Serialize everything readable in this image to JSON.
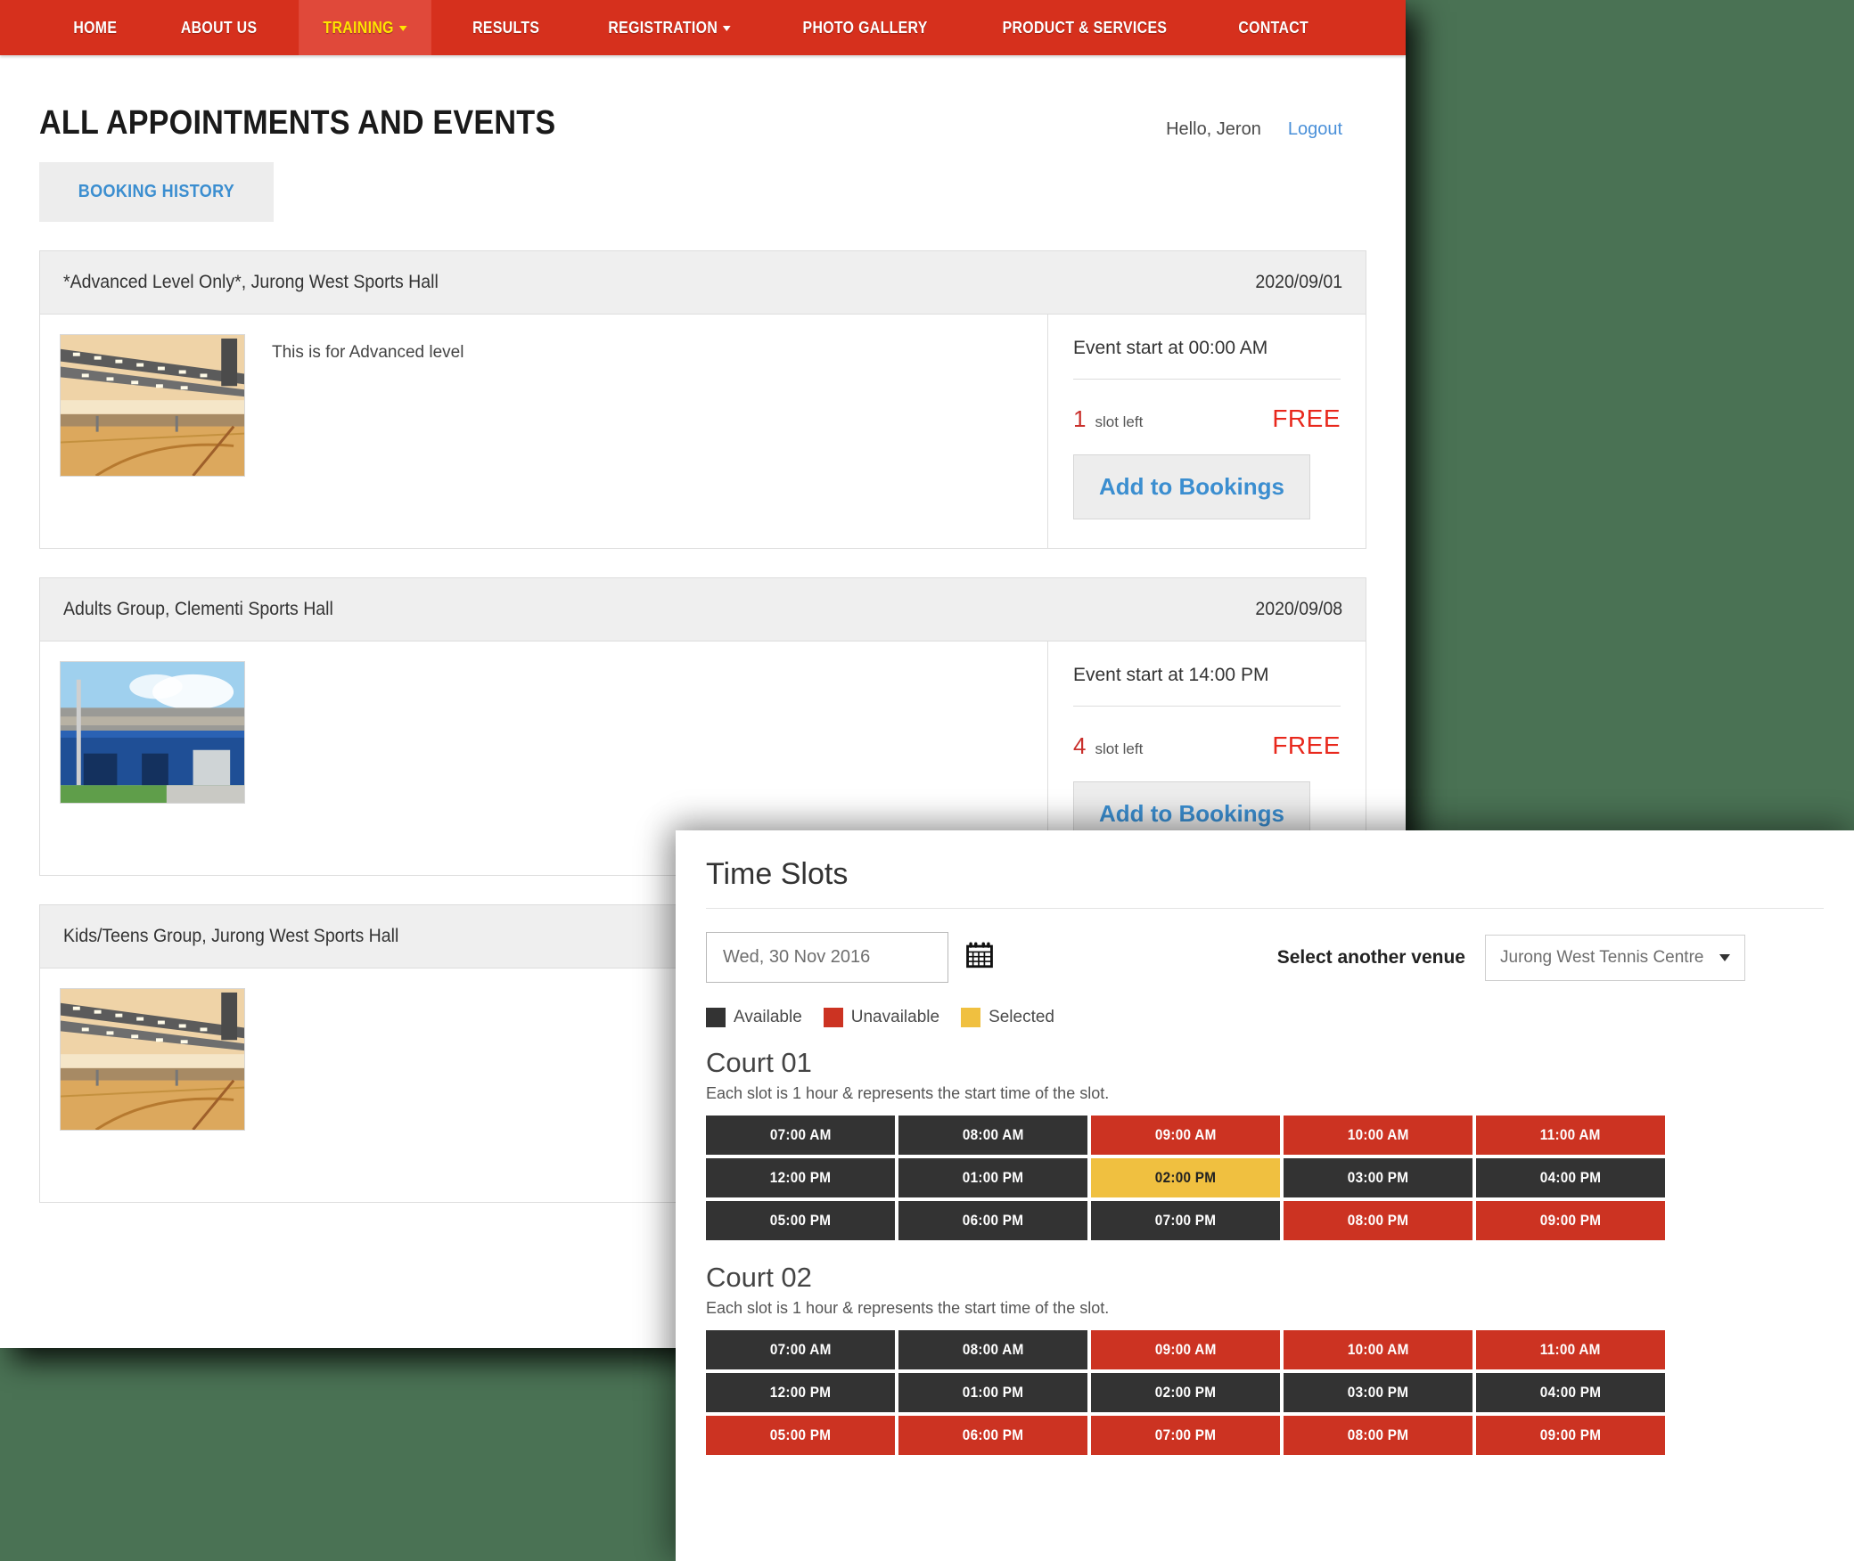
{
  "nav": {
    "items": [
      {
        "label": "HOME",
        "active": false,
        "caret": false
      },
      {
        "label": "ABOUT US",
        "active": false,
        "caret": false
      },
      {
        "label": "TRAINING",
        "active": true,
        "caret": true
      },
      {
        "label": "RESULTS",
        "active": false,
        "caret": false
      },
      {
        "label": "REGISTRATION",
        "active": false,
        "caret": true
      },
      {
        "label": "PHOTO GALLERY",
        "active": false,
        "caret": false
      },
      {
        "label": "PRODUCT & SERVICES",
        "active": false,
        "caret": false
      },
      {
        "label": "CONTACT",
        "active": false,
        "caret": false
      }
    ],
    "bar_color": "#d6301d",
    "active_text_color": "#ffe500"
  },
  "header": {
    "page_title": "ALL APPOINTMENTS AND EVENTS",
    "greeting": "Hello, Jeron",
    "logout_label": "Logout",
    "booking_history_label": "BOOKING HISTORY"
  },
  "events": [
    {
      "title": "*Advanced Level Only*, Jurong West Sports Hall",
      "date": "2020/09/01",
      "description": "This is for Advanced level",
      "event_start": "Event start at 00:00 AM",
      "slots_left_number": "1",
      "slots_left_label": "slot left",
      "price": "FREE",
      "add_button_label": "Add to Bookings",
      "image": "sports-hall-interior"
    },
    {
      "title": "Adults Group, Clementi Sports Hall",
      "date": "2020/09/08",
      "description": "",
      "event_start": "Event start at 14:00 PM",
      "slots_left_number": "4",
      "slots_left_label": "slot left",
      "price": "FREE",
      "add_button_label": "Add to Bookings",
      "image": "clementi-sports-hall-exterior"
    },
    {
      "title": "Kids/Teens Group, Jurong West Sports Hall",
      "date": "",
      "description": "",
      "event_start": "",
      "slots_left_number": "",
      "slots_left_label": "",
      "price": "",
      "add_button_label": "",
      "image": "sports-hall-interior"
    }
  ],
  "modal": {
    "title": "Time Slots",
    "date_value": "Wed, 30 Nov 2016",
    "calendar_icon": "calendar-icon",
    "venue_label": "Select another venue",
    "venue_value": "Jurong West Tennis Centre",
    "legend": [
      {
        "label": "Available",
        "color": "#333333"
      },
      {
        "label": "Unavailable",
        "color": "#cc3322"
      },
      {
        "label": "Selected",
        "color": "#f0c040"
      }
    ],
    "courts": [
      {
        "name": "Court 01",
        "note": "Each slot is 1 hour & represents the start time of the slot.",
        "slots": [
          {
            "time": "07:00 AM",
            "state": "available"
          },
          {
            "time": "08:00 AM",
            "state": "available"
          },
          {
            "time": "09:00 AM",
            "state": "unavailable"
          },
          {
            "time": "10:00 AM",
            "state": "unavailable"
          },
          {
            "time": "11:00 AM",
            "state": "unavailable"
          },
          {
            "time": "12:00 PM",
            "state": "available"
          },
          {
            "time": "01:00 PM",
            "state": "available"
          },
          {
            "time": "02:00 PM",
            "state": "selected"
          },
          {
            "time": "03:00 PM",
            "state": "available"
          },
          {
            "time": "04:00 PM",
            "state": "available"
          },
          {
            "time": "05:00 PM",
            "state": "available"
          },
          {
            "time": "06:00 PM",
            "state": "available"
          },
          {
            "time": "07:00 PM",
            "state": "available"
          },
          {
            "time": "08:00 PM",
            "state": "unavailable"
          },
          {
            "time": "09:00 PM",
            "state": "unavailable"
          }
        ]
      },
      {
        "name": "Court 02",
        "note": "Each slot is 1 hour & represents the start time of the slot.",
        "slots": [
          {
            "time": "07:00 AM",
            "state": "available"
          },
          {
            "time": "08:00 AM",
            "state": "available"
          },
          {
            "time": "09:00 AM",
            "state": "unavailable"
          },
          {
            "time": "10:00 AM",
            "state": "unavailable"
          },
          {
            "time": "11:00 AM",
            "state": "unavailable"
          },
          {
            "time": "12:00 PM",
            "state": "available"
          },
          {
            "time": "01:00 PM",
            "state": "available"
          },
          {
            "time": "02:00 PM",
            "state": "available"
          },
          {
            "time": "03:00 PM",
            "state": "available"
          },
          {
            "time": "04:00 PM",
            "state": "available"
          },
          {
            "time": "05:00 PM",
            "state": "unavailable"
          },
          {
            "time": "06:00 PM",
            "state": "unavailable"
          },
          {
            "time": "07:00 PM",
            "state": "unavailable"
          },
          {
            "time": "08:00 PM",
            "state": "unavailable"
          },
          {
            "time": "09:00 PM",
            "state": "unavailable"
          }
        ]
      }
    ]
  }
}
